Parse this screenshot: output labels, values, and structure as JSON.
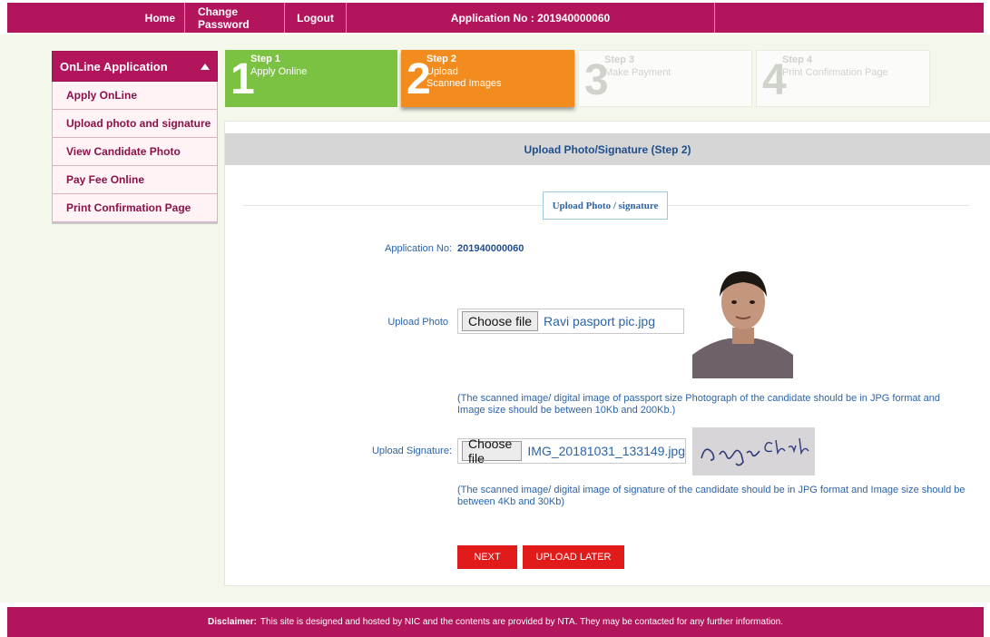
{
  "nav": {
    "home": "Home",
    "change_password": "Change Password",
    "logout": "Logout",
    "application_no": "Application No : 201940000060"
  },
  "sidebar": {
    "title": "OnLine Application",
    "items": [
      {
        "label": "Apply OnLine"
      },
      {
        "label": "Upload photo and signature"
      },
      {
        "label": "View Candidate Photo"
      },
      {
        "label": "Pay Fee Online"
      },
      {
        "label": "Print Confirmation Page"
      }
    ]
  },
  "steps": [
    {
      "num": "1",
      "title": "Step 1",
      "sub1": "Apply Online",
      "sub2": ""
    },
    {
      "num": "2",
      "title": "Step 2",
      "sub1": "Upload",
      "sub2": "Scanned Images"
    },
    {
      "num": "3",
      "title": "Step 3",
      "sub1": "Make Payment",
      "sub2": ""
    },
    {
      "num": "4",
      "title": "Step 4",
      "sub1": "Print Confirmation Page",
      "sub2": ""
    }
  ],
  "panel": {
    "header": "Upload Photo/Signature (Step 2)",
    "tab": "Upload Photo / signature",
    "app_no_label": "Application No:",
    "app_no_value": "201940000060",
    "photo_label": "Upload Photo",
    "photo_button": "Choose file",
    "photo_file": "Ravi pasport pic.jpg",
    "photo_note": "(The scanned image/ digital image of passport size Photograph of the candidate should be in JPG format and Image size should be between 10Kb and 200Kb.)",
    "sig_label": "Upload Signature:",
    "sig_button": "Choose file",
    "sig_file": "IMG_20181031_133149.jpg",
    "sig_note": "(The scanned image/ digital image of signature of the candidate should be in JPG format and Image size should be between 4Kb and 30Kb)",
    "next": "NEXT",
    "upload_later": "UPLOAD LATER"
  },
  "footer": {
    "bold": "Disclaimer:",
    "text": "This site is designed and hosted by NIC and the contents are provided by NTA. They may be contacted for any further information."
  },
  "colors": {
    "brand": "#b3155c",
    "step1": "#7cc242",
    "step2": "#f28c1e",
    "button": "#e11a1a"
  }
}
